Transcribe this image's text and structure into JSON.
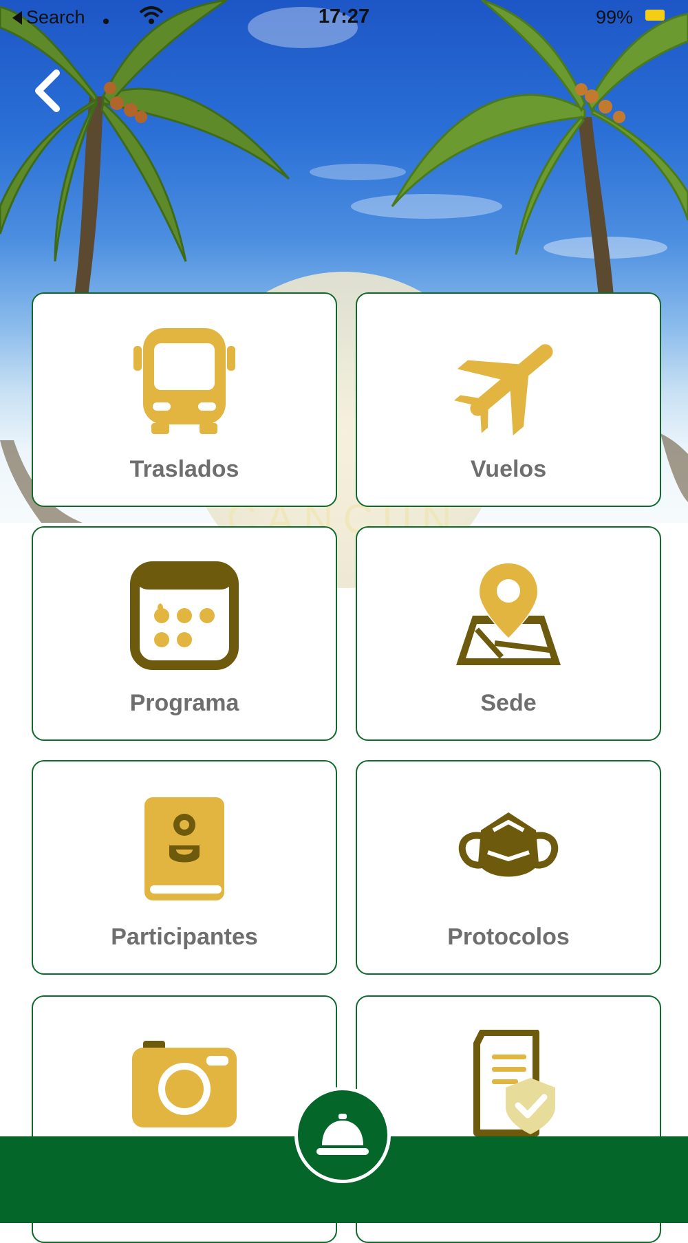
{
  "status_bar": {
    "back_app": "Search",
    "time": "17:27",
    "battery": "99%"
  },
  "header": {
    "back_icon": "chevron-left-icon",
    "logo_text": "CANCÚN"
  },
  "tiles": [
    {
      "label": "Traslados",
      "icon": "bus-icon"
    },
    {
      "label": "Vuelos",
      "icon": "airplane-icon"
    },
    {
      "label": "Programa",
      "icon": "calendar-icon"
    },
    {
      "label": "Sede",
      "icon": "map-pin-icon"
    },
    {
      "label": "Participantes",
      "icon": "contact-book-icon"
    },
    {
      "label": "Protocolos",
      "icon": "face-mask-icon"
    },
    {
      "label": "",
      "icon": "camera-icon"
    },
    {
      "label": "",
      "icon": "document-shield-icon"
    }
  ],
  "bottom_bar": {
    "center_icon": "service-bell-icon"
  },
  "colors": {
    "accent_green": "#05662a",
    "tile_border": "#0f6a2a",
    "icon_gold": "#e2b540",
    "icon_olive": "#6e5a0c",
    "label_gray": "#6e6e6e"
  }
}
